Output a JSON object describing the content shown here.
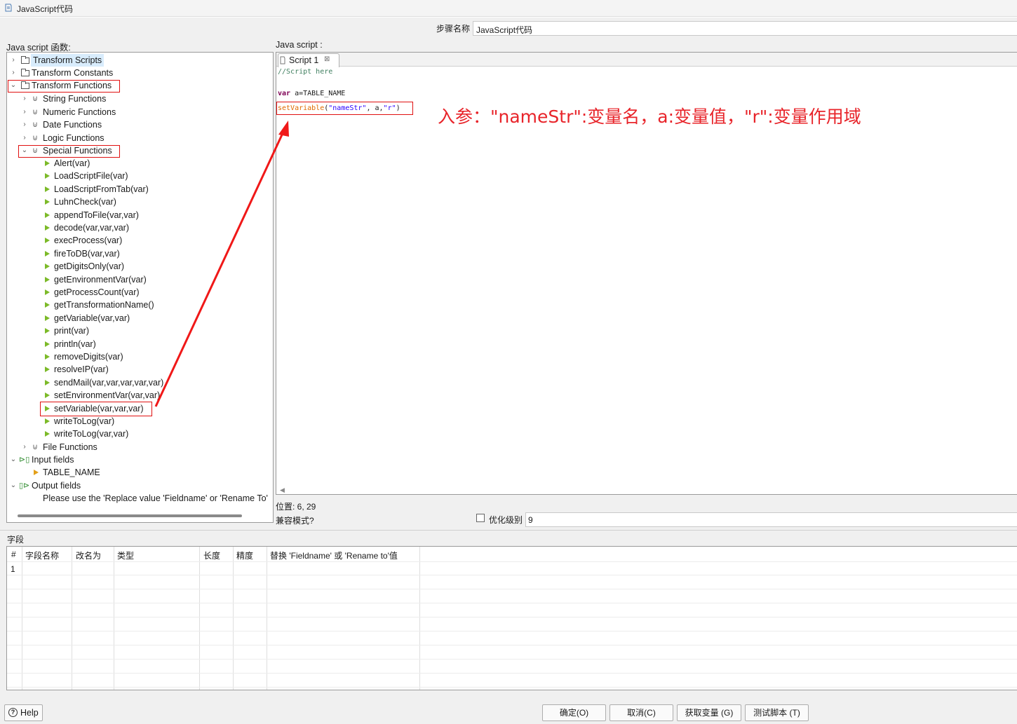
{
  "window": {
    "title": "JavaScript代码"
  },
  "step_name": {
    "label": "步骤名称",
    "value": "JavaScript代码"
  },
  "functions_panel": {
    "label": "Java script 函数:",
    "transform_scripts": "Transform Scripts",
    "transform_constants": "Transform Constants",
    "transform_functions": "Transform Functions",
    "categories": [
      "String Functions",
      "Numeric Functions",
      "Date Functions",
      "Logic Functions"
    ],
    "special_functions": "Special Functions",
    "special_items": [
      "Alert(var)",
      "LoadScriptFile(var)",
      "LoadScriptFromTab(var)",
      "LuhnCheck(var)",
      "appendToFile(var,var)",
      "decode(var,var,var)",
      "execProcess(var)",
      "fireToDB(var,var)",
      "getDigitsOnly(var)",
      "getEnvironmentVar(var)",
      "getProcessCount(var)",
      "getTransformationName()",
      "getVariable(var,var)",
      "print(var)",
      "println(var)",
      "removeDigits(var)",
      "resolveIP(var)",
      "sendMail(var,var,var,var,var)",
      "setEnvironmentVar(var,var)",
      "setVariable(var,var,var)",
      "writeToLog(var)",
      "writeToLog(var,var)"
    ],
    "file_functions": "File Functions",
    "input_fields": "Input fields",
    "input_field_items": [
      "TABLE_NAME"
    ],
    "output_fields": "Output fields",
    "output_note": "Please use the 'Replace value 'Fieldname' or 'Rename To'"
  },
  "editor": {
    "label": "Java script :",
    "tab_label": "Script 1",
    "code": {
      "line1": "//Script here",
      "line3_kw": "var",
      "line3_rest": " a=TABLE_NAME",
      "line4_fn": "setVariable",
      "line4_open": "(",
      "line4_str1": "\"nameStr\"",
      "line4_mid": ", a,",
      "line4_str2": "\"r\"",
      "line4_close": ")"
    },
    "annotation": "入参：\"nameStr\":变量名，a:变量值，\"r\":变量作用域",
    "position_label": "位置: 6, 29",
    "compat_label": "兼容模式?",
    "optimize_label": "优化级别",
    "optimize_value": "9"
  },
  "fields": {
    "label": "字段",
    "columns": [
      "#",
      "字段名称",
      "改名为",
      "类型",
      "长度",
      "精度",
      "替换 'Fieldname' 或 'Rename to'值"
    ],
    "rows": [
      [
        "1",
        "",
        "",
        "",
        "",
        "",
        ""
      ]
    ]
  },
  "buttons": {
    "help": "Help",
    "ok": "确定(O)",
    "cancel": "取消(C)",
    "get_vars": "获取变量 (G)",
    "test": "测试脚本 (T)"
  },
  "colors": {
    "highlight_red": "#e01010",
    "annotation_red": "#e8242a"
  }
}
